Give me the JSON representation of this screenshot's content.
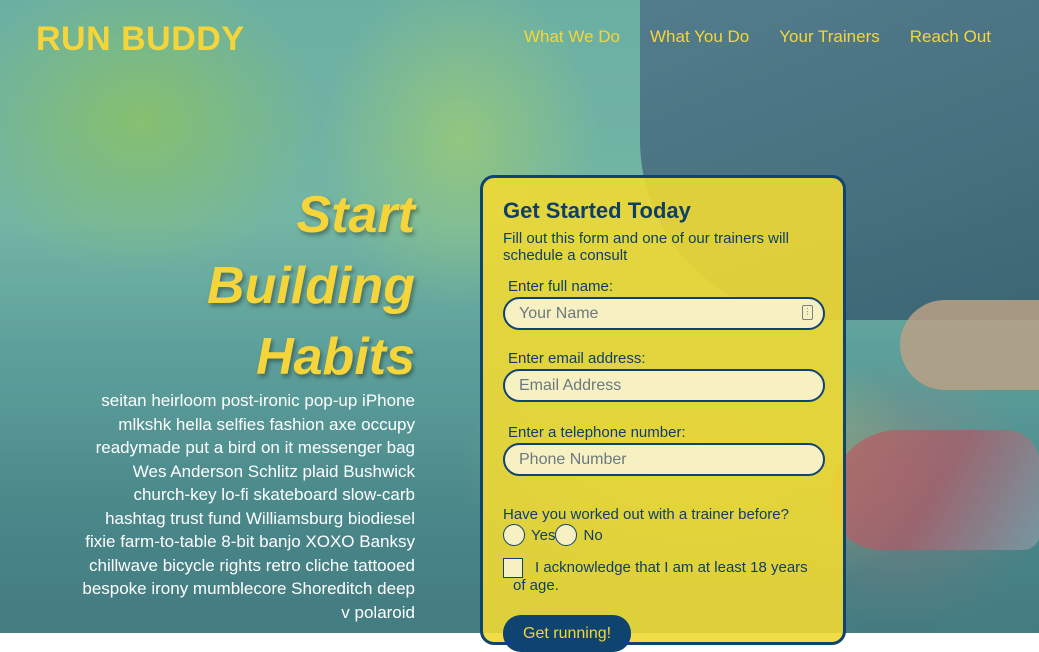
{
  "header": {
    "logo": "RUN BUDDY",
    "nav": [
      {
        "label": "What We Do"
      },
      {
        "label": "What You Do"
      },
      {
        "label": "Your Trainers"
      },
      {
        "label": "Reach Out"
      }
    ]
  },
  "hero": {
    "headline_lines": [
      "Start",
      "Building",
      "Habits"
    ],
    "intro": "seitan heirloom post-ironic pop-up iPhone mlkshk hella selfies fashion axe occupy readymade put a bird on it messenger bag Wes Anderson Schlitz plaid Bushwick church-key lo-fi skateboard slow-carb hashtag trust fund Williamsburg biodiesel fixie farm-to-table 8-bit banjo XOXO Banksy chillwave bicycle rights retro cliche tattooed bespoke irony mumblecore Shoreditch deep v polaroid"
  },
  "form": {
    "title": "Get Started Today",
    "subtitle": "Fill out this form and one of our trainers will schedule a consult",
    "fields": [
      {
        "label": "Enter full name:",
        "placeholder": "Your Name"
      },
      {
        "label": "Enter email address:",
        "placeholder": "Email Address"
      },
      {
        "label": "Enter a telephone number:",
        "placeholder": "Phone Number"
      }
    ],
    "question": "Have you worked out with a trainer before?",
    "options": [
      "Yes",
      "No"
    ],
    "acknowledge": "I acknowledge that I am at least 18 years of age.",
    "submit_label": "Get running!"
  },
  "colors": {
    "accent_yellow": "#f5d53a",
    "navy": "#0f4370"
  },
  "icons": {
    "name_field": "contact-card-icon"
  }
}
